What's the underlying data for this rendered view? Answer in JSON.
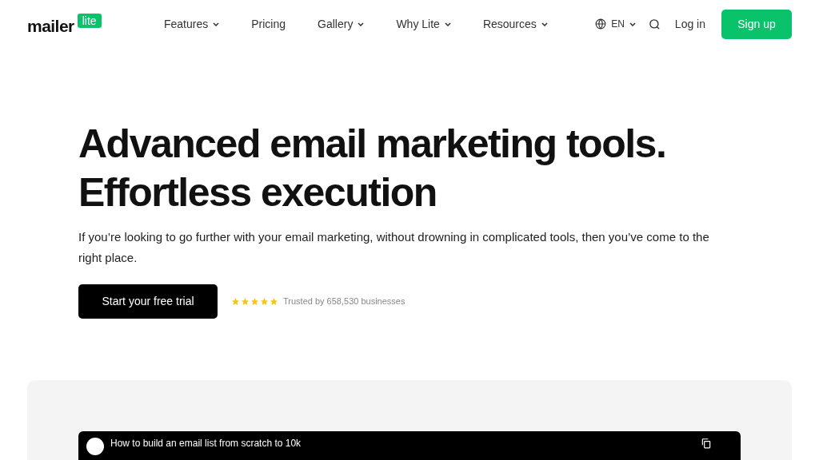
{
  "header": {
    "logo": {
      "word": "mailer",
      "badge": "lite"
    },
    "nav": [
      {
        "label": "Features",
        "dropdown": true
      },
      {
        "label": "Pricing",
        "dropdown": false
      },
      {
        "label": "Gallery",
        "dropdown": true
      },
      {
        "label": "Why Lite",
        "dropdown": true
      },
      {
        "label": "Resources",
        "dropdown": true
      }
    ],
    "language": "EN",
    "login": "Log in",
    "signup": "Sign up"
  },
  "hero": {
    "title_lines": [
      "Advanced email marketing tools.",
      "Effortless execution"
    ],
    "subtitle": "If you’re looking to go further with your email marketing, without drowning in complicated tools, then you’ve come to the right place.",
    "cta": "Start your free trial",
    "stars": 5,
    "trust": "Trusted by 658,530 businesses"
  },
  "video": {
    "title": "How to build an email list from scratch to 10k"
  }
}
